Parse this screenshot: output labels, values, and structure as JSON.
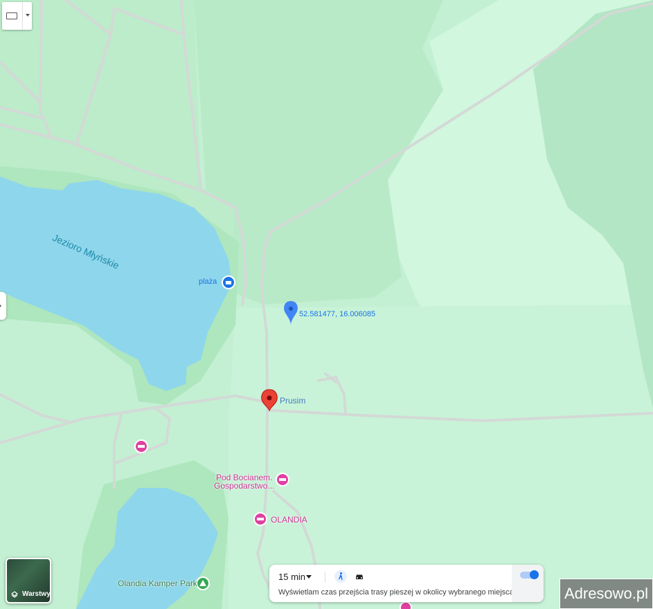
{
  "map": {
    "lakes": [
      {
        "name": "Jezioro Młyńskie"
      }
    ],
    "places": {
      "beach": "plaża",
      "village": "Prusim",
      "coordinates": "52.581477, 16.006085",
      "lodging_1": "Pod Bocianem.\nGospodarstwo...",
      "lodging_2": "OLANDIA",
      "camping": "Olandia Kamper Park"
    },
    "colors": {
      "land": "#c3f0d3",
      "forest": "#b6e8c6",
      "meadow": "#d1f7df",
      "water": "#8ed6ec",
      "road": "#d7dcd9",
      "pin_red": "#ea4335",
      "pin_blue": "#4285f4",
      "poi_pink": "#e040a0",
      "poi_green": "#34a853"
    },
    "icons": [
      "keyboard-icon",
      "chevron-down-icon",
      "beach-icon",
      "location-pin-icon",
      "red-pin-icon",
      "hotel-icon",
      "campground-icon",
      "layers-icon",
      "walk-icon",
      "car-icon"
    ]
  },
  "controls": {
    "layers_label": "Warstwy",
    "travel_time": "15 min",
    "travel_description": "Wyświetlam czas przejścia trasy pieszej w okolicy wybranego miejsca",
    "toggle_on": true
  },
  "watermark": "Adresowo.pl"
}
